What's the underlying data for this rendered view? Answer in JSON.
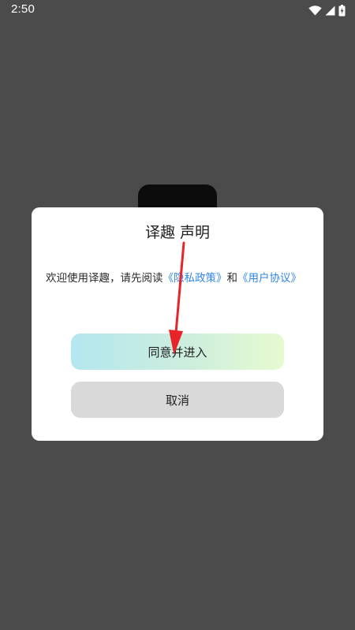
{
  "statusbar": {
    "time": "2:50",
    "icons": [
      "wifi-icon",
      "signal-icon",
      "battery-icon"
    ]
  },
  "dialog": {
    "title": "译趣 声明",
    "text_prefix": "欢迎使用译趣，请先阅读",
    "privacy_link": "《隐私政策》",
    "conjunction": "和",
    "agreement_link": "《用户协议》",
    "agree_button": "同意并进入",
    "cancel_button": "取消"
  },
  "colors": {
    "overlay": "#4b4b4b",
    "link": "#2f86e6",
    "agree_gradient_start": "#b3e7ef",
    "agree_gradient_end": "#e6fad0",
    "cancel_bg": "#d9d9d9",
    "annotation_arrow": "#e8242a"
  }
}
